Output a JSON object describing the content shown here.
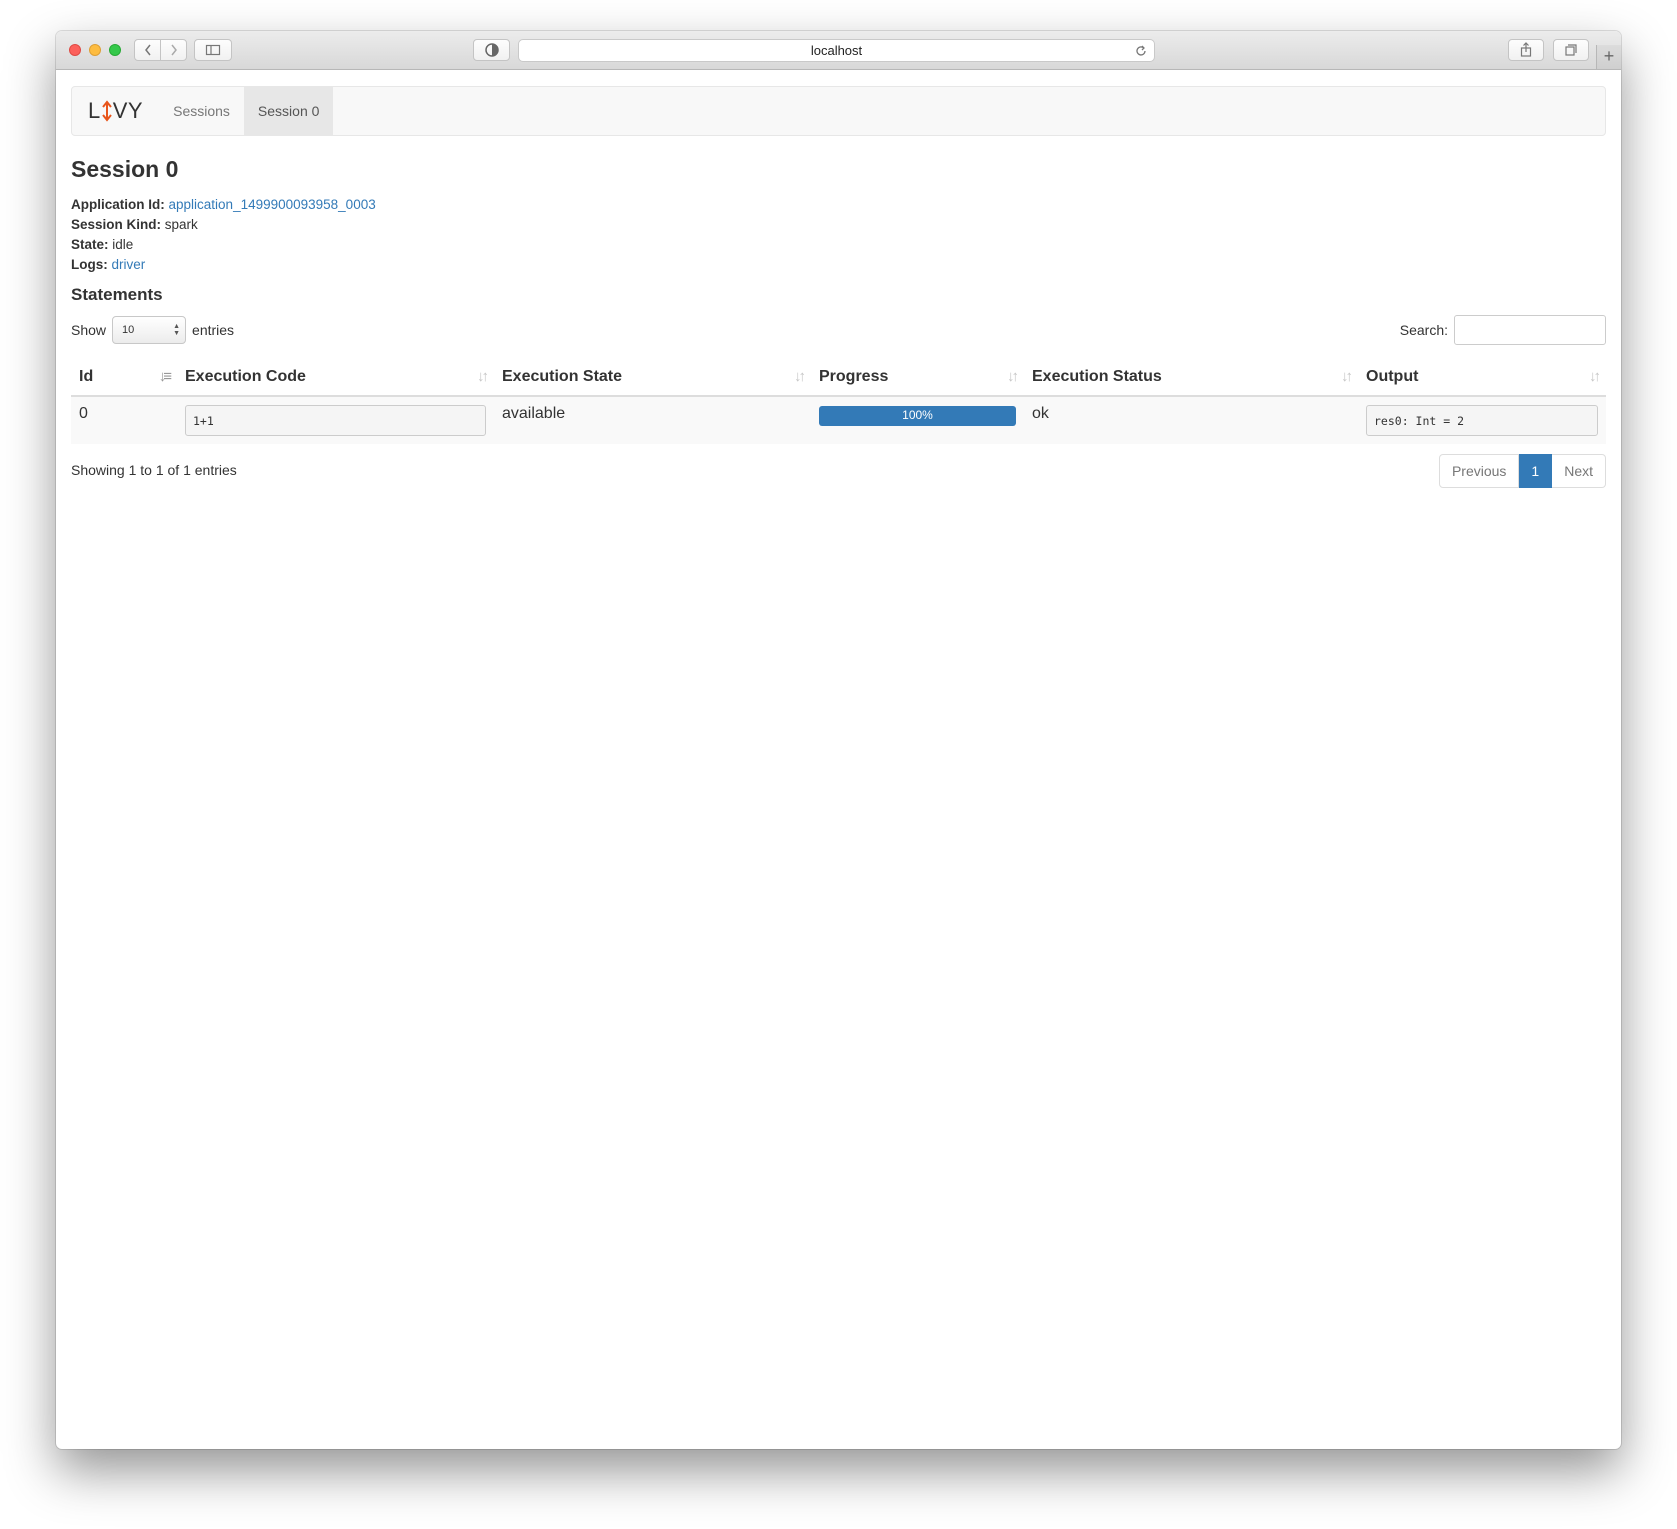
{
  "browser": {
    "url": "localhost"
  },
  "nav": {
    "brand_left": "L",
    "brand_right": "VY",
    "links": [
      "Sessions",
      "Session 0"
    ],
    "active_index": 1
  },
  "page": {
    "title": "Session 0",
    "info": {
      "app_id_label": "Application Id:",
      "app_id_value": "application_1499900093958_0003",
      "kind_label": "Session Kind:",
      "kind_value": "spark",
      "state_label": "State:",
      "state_value": "idle",
      "logs_label": "Logs:",
      "logs_value": "driver"
    }
  },
  "statements": {
    "heading": "Statements",
    "show_label": "Show",
    "entries_label": "entries",
    "page_size": "10",
    "search_label": "Search:",
    "search_value": "",
    "columns": [
      "Id",
      "Execution Code",
      "Execution State",
      "Progress",
      "Execution Status",
      "Output"
    ],
    "rows": [
      {
        "id": "0",
        "code": "1+1",
        "state": "available",
        "progress": 1.0,
        "progress_label": "100%",
        "status": "ok",
        "output": "res0: Int = 2"
      }
    ],
    "showing_text": "Showing 1 to 1 of 1 entries",
    "pager": {
      "previous": "Previous",
      "current": "1",
      "next": "Next"
    }
  },
  "colors": {
    "primary": "#337ab7",
    "brand_arrow": "#e8551b"
  }
}
